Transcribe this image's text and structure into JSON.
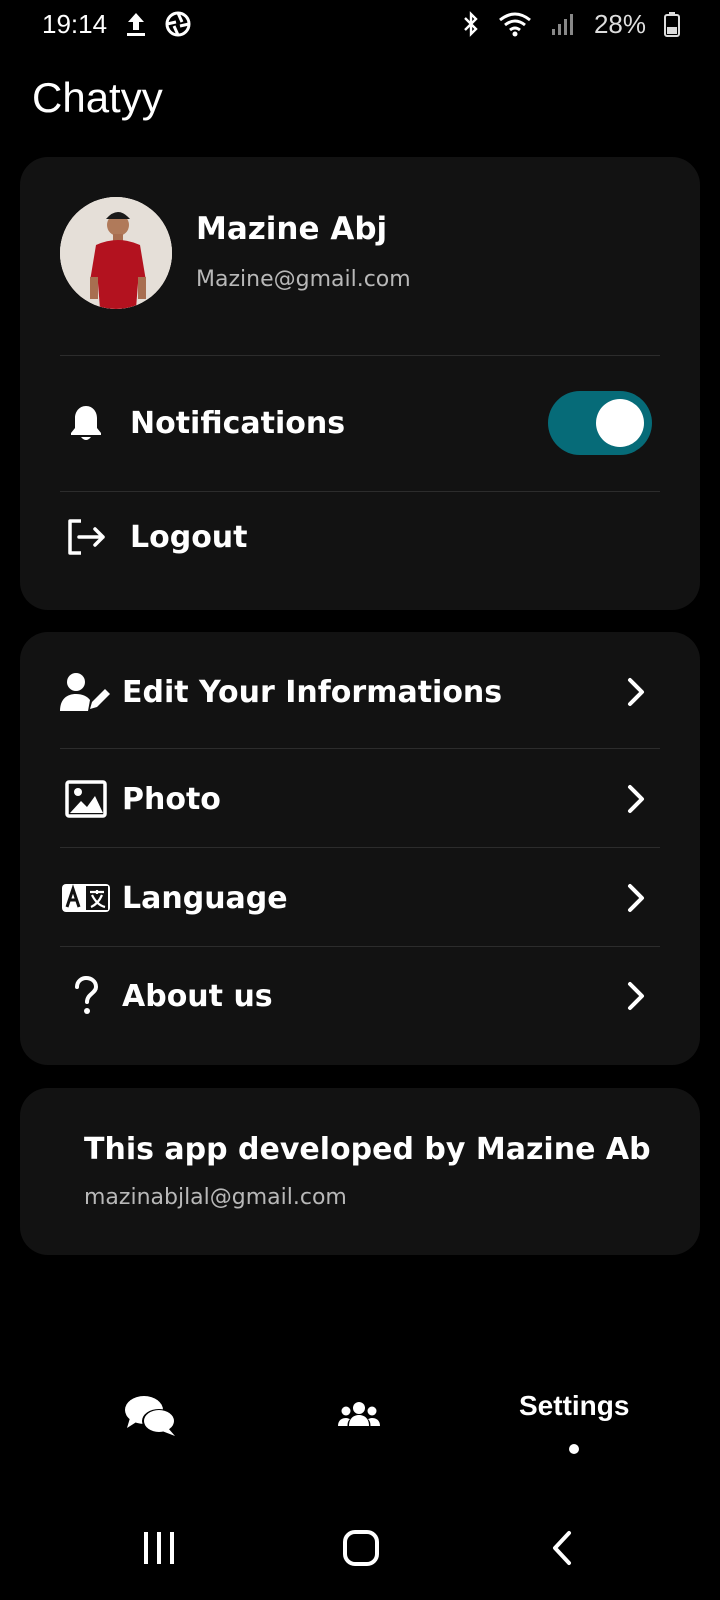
{
  "status_bar": {
    "time": "19:14",
    "battery_percent": "28%"
  },
  "app": {
    "title": "Chatyy"
  },
  "profile": {
    "name": "Mazine Abj",
    "email": "Mazine@gmail.com"
  },
  "account_actions": {
    "notifications_label": "Notifications",
    "notifications_enabled": true,
    "logout_label": "Logout"
  },
  "menu": {
    "items": [
      {
        "label": "Edit Your Informations",
        "icon": "user-edit-icon"
      },
      {
        "label": "Photo",
        "icon": "image-icon"
      },
      {
        "label": "Language",
        "icon": "translate-icon"
      },
      {
        "label": "About us",
        "icon": "question-icon"
      }
    ]
  },
  "about": {
    "title": "This app developed by Mazine Ab",
    "email": "mazinabjlal@gmail.com"
  },
  "bottom_nav": {
    "chats_icon": "chat-bubbles-icon",
    "groups_icon": "users-icon",
    "settings_label": "Settings"
  },
  "colors": {
    "background": "#000000",
    "card": "#121212",
    "toggle_on": "#066b78",
    "secondary_text": "#b8b8b8"
  }
}
